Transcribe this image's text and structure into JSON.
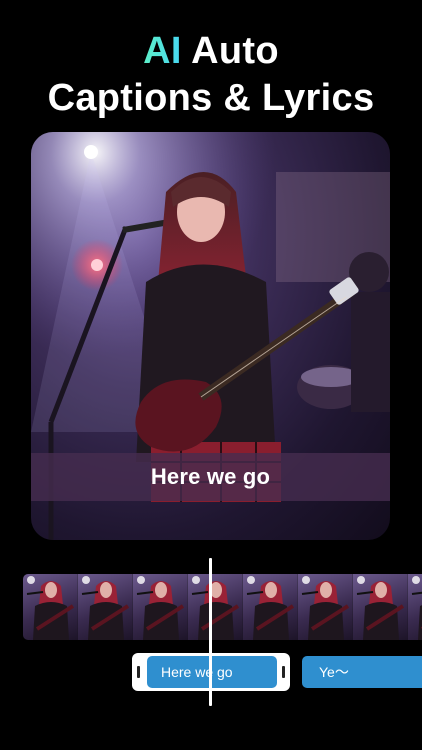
{
  "headline": {
    "accent": "AI",
    "line1_rest": " Auto",
    "line2": "Captions & Lyrics"
  },
  "preview": {
    "caption": "Here we go"
  },
  "timeline": {
    "frames": 8,
    "captions": [
      {
        "label": "Here we go",
        "selected": true
      },
      {
        "label": "Ye～",
        "selected": false
      }
    ]
  },
  "colors": {
    "accent_gradient_start": "#5ef0c8",
    "accent_gradient_end": "#46d6f2",
    "caption_chip": "#2f8fcf",
    "background": "#000000"
  }
}
